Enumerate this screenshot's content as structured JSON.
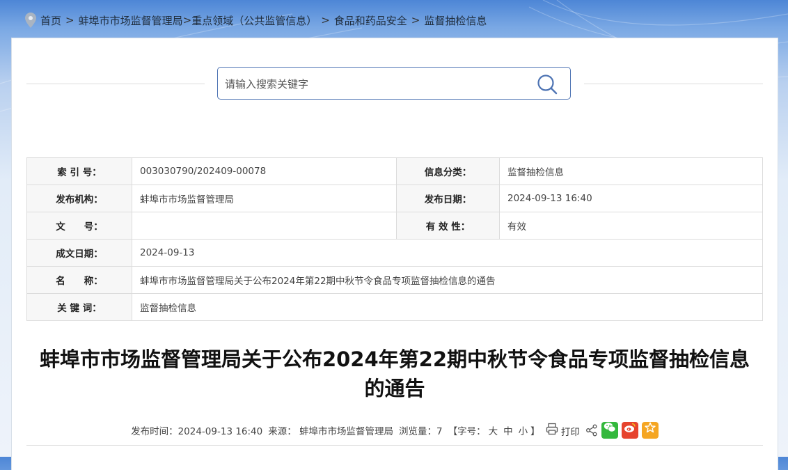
{
  "breadcrumb": {
    "home": "首页",
    "sep": ">",
    "l1": "蚌埠市市场监督管理局",
    "l2": "重点领域（公共监管信息）",
    "l3": "食品和药品安全",
    "l4": "监督抽检信息"
  },
  "search": {
    "placeholder": "请输入搜索关键字"
  },
  "meta": {
    "index_label": "索 引 号：",
    "index_value": "003030790/202409-00078",
    "category_label": "信息分类：",
    "category_value": "监督抽检信息",
    "org_label": "发布机构：",
    "org_value": "蚌埠市市场监督管理局",
    "pubdate_label": "发布日期：",
    "pubdate_value": "2024-09-13 16:40",
    "docno_label": "文　　号：",
    "docno_value": "",
    "validity_label": "有 效 性：",
    "validity_value": "有效",
    "date_label": "成文日期：",
    "date_value": "2024-09-13",
    "name_label": "名　　称：",
    "name_value": "蚌埠市市场监督管理局关于公布2024年第22期中秋节令食品专项监督抽检信息的通告",
    "keyword_label": "关 键 词：",
    "keyword_value": "监督抽检信息"
  },
  "article": {
    "title": "蚌埠市市场监督管理局关于公布2024年第22期中秋节令食品专项监督抽检信息的通告",
    "pub_time": "发布时间：2024-09-13 16:40",
    "source": "来源： 蚌埠市市场监督管理局",
    "views": "浏览量：7",
    "font_open": "【字号：",
    "font_large": "大",
    "font_medium": "中",
    "font_small": "小",
    "font_close": "】",
    "print": "打印"
  },
  "colors": {
    "wechat": "#34b83d",
    "weibo": "#e6432d",
    "favorite": "#f5a623",
    "search_border": "#4d73b3"
  }
}
